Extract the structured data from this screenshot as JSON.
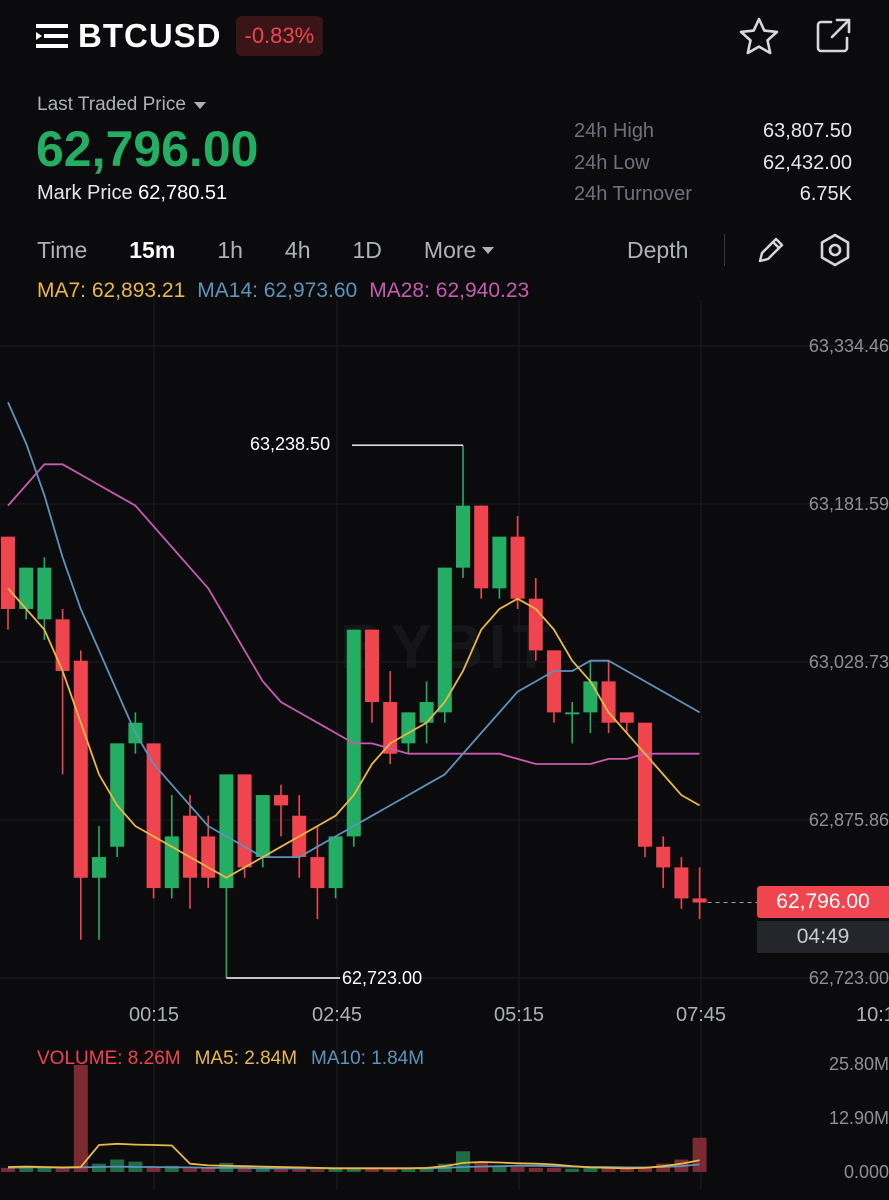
{
  "header": {
    "symbol": "BTCUSD",
    "change": "-0.83%"
  },
  "price": {
    "label": "Last Traded Price",
    "last": "62,796.00",
    "mark_label": "Mark Price",
    "mark": "62,780.51"
  },
  "stats": [
    {
      "label": "24h High",
      "value": "63,807.50"
    },
    {
      "label": "24h Low",
      "value": "62,432.00"
    },
    {
      "label": "24h Turnover",
      "value": "6.75K"
    }
  ],
  "timeframes": [
    "Time",
    "15m",
    "1h",
    "4h",
    "1D"
  ],
  "active_timeframe": "15m",
  "more_label": "More",
  "depth_label": "Depth",
  "ma_legend": {
    "ma7": "MA7: 62,893.21",
    "ma14": "MA14: 62,973.60",
    "ma28": "MA28: 62,940.23"
  },
  "volume_legend": {
    "volume": "VOLUME: 8.26M",
    "ma5": "MA5: 2.84M",
    "ma10": "MA10: 1.84M"
  },
  "watermark": "BYBIT",
  "colors": {
    "up": "#24ae64",
    "down": "#f0444f",
    "ma7": "#e9b845",
    "ma14": "#5c93bb",
    "ma28": "#c75bb1"
  },
  "icons": [
    "menu-icon",
    "star-icon",
    "share-icon",
    "pencil-icon",
    "settings-icon"
  ],
  "chart_data": {
    "type": "candlestick",
    "interval": "15m",
    "y_axis_labels": [
      "63,334.46",
      "63,181.59",
      "63,028.73",
      "62,875.86",
      "62,723.00"
    ],
    "ylim": [
      62723.0,
      63334.46
    ],
    "x_axis_labels": [
      "00:15",
      "02:45",
      "05:15",
      "07:45",
      "10:1"
    ],
    "high_marker": "63,238.50",
    "low_marker": "62,723.00",
    "current_price": "62,796.00",
    "countdown": "04:49",
    "candles": [
      {
        "o": 63150,
        "h": 63150,
        "c": 63080,
        "l": 63060
      },
      {
        "o": 63080,
        "h": 63120,
        "c": 63120,
        "l": 63070
      },
      {
        "o": 63070,
        "h": 63130,
        "c": 63120,
        "l": 63050
      },
      {
        "o": 63070,
        "h": 63080,
        "c": 63020,
        "l": 62920
      },
      {
        "o": 63030,
        "h": 63040,
        "c": 62820,
        "l": 62760
      },
      {
        "o": 62820,
        "h": 62870,
        "c": 62840,
        "l": 62760
      },
      {
        "o": 62850,
        "h": 62950,
        "c": 62950,
        "l": 62840
      },
      {
        "o": 62950,
        "h": 62980,
        "c": 62970,
        "l": 62940
      },
      {
        "o": 62950,
        "h": 62950,
        "c": 62810,
        "l": 62800
      },
      {
        "o": 62810,
        "h": 62900,
        "c": 62860,
        "l": 62800
      },
      {
        "o": 62880,
        "h": 62900,
        "c": 62820,
        "l": 62790
      },
      {
        "o": 62860,
        "h": 62880,
        "c": 62820,
        "l": 62810
      },
      {
        "o": 62810,
        "h": 62920,
        "c": 62920,
        "l": 62723
      },
      {
        "o": 62920,
        "h": 62920,
        "c": 62830,
        "l": 62820
      },
      {
        "o": 62840,
        "h": 62900,
        "c": 62900,
        "l": 62830
      },
      {
        "o": 62900,
        "h": 62910,
        "c": 62890,
        "l": 62860
      },
      {
        "o": 62880,
        "h": 62900,
        "c": 62840,
        "l": 62820
      },
      {
        "o": 62840,
        "h": 62870,
        "c": 62810,
        "l": 62780
      },
      {
        "o": 62810,
        "h": 62860,
        "c": 62860,
        "l": 62800
      },
      {
        "o": 62860,
        "h": 63060,
        "c": 63060,
        "l": 62850
      },
      {
        "o": 63060,
        "h": 63050,
        "c": 62990,
        "l": 62970
      },
      {
        "o": 62990,
        "h": 63020,
        "c": 62940,
        "l": 62930
      },
      {
        "o": 62950,
        "h": 62980,
        "c": 62980,
        "l": 62940
      },
      {
        "o": 62970,
        "h": 63010,
        "c": 62990,
        "l": 62950
      },
      {
        "o": 62980,
        "h": 63120,
        "c": 63120,
        "l": 62970
      },
      {
        "o": 63120,
        "h": 63238.5,
        "c": 63180,
        "l": 63110
      },
      {
        "o": 63180,
        "h": 63180,
        "c": 63100,
        "l": 63090
      },
      {
        "o": 63100,
        "h": 63140,
        "c": 63150,
        "l": 63090
      },
      {
        "o": 63150,
        "h": 63170,
        "c": 63090,
        "l": 63080
      },
      {
        "o": 63090,
        "h": 63110,
        "c": 63040,
        "l": 63030
      },
      {
        "o": 63040,
        "h": 63040,
        "c": 62980,
        "l": 62970
      },
      {
        "o": 62980,
        "h": 62990,
        "c": 62980,
        "l": 62950
      },
      {
        "o": 62980,
        "h": 63030,
        "c": 63010,
        "l": 62960
      },
      {
        "o": 63010,
        "h": 63030,
        "c": 62970,
        "l": 62960
      },
      {
        "o": 62980,
        "h": 62980,
        "c": 62970,
        "l": 62960
      },
      {
        "o": 62970,
        "h": 62970,
        "c": 62850,
        "l": 62840
      },
      {
        "o": 62850,
        "h": 62860,
        "c": 62830,
        "l": 62810
      },
      {
        "o": 62830,
        "h": 62840,
        "c": 62800,
        "l": 62790
      },
      {
        "o": 62800,
        "h": 62830,
        "c": 62796,
        "l": 62780
      }
    ],
    "ma7": [
      63100,
      63080,
      63060,
      63020,
      62970,
      62920,
      62890,
      62870,
      62860,
      62850,
      62840,
      62830,
      62820,
      62830,
      62840,
      62850,
      62860,
      62870,
      62880,
      62900,
      62930,
      62950,
      62960,
      62970,
      62990,
      63020,
      63060,
      63080,
      63090,
      63080,
      63060,
      63030,
      63010,
      62980,
      62960,
      62940,
      62920,
      62900,
      62890
    ],
    "ma14": [
      63280,
      63240,
      63190,
      63130,
      63080,
      63040,
      63000,
      62960,
      62930,
      62910,
      62890,
      62870,
      62860,
      62850,
      62840,
      62840,
      62840,
      62850,
      62860,
      62870,
      62880,
      62890,
      62900,
      62910,
      62920,
      62940,
      62960,
      62980,
      63000,
      63010,
      63020,
      63020,
      63030,
      63030,
      63020,
      63010,
      63000,
      62990,
      62980
    ],
    "ma28": [
      63180,
      63200,
      63220,
      63220,
      63210,
      63200,
      63190,
      63180,
      63160,
      63140,
      63120,
      63100,
      63070,
      63040,
      63010,
      62990,
      62980,
      62970,
      62960,
      62950,
      62950,
      62945,
      62940,
      62940,
      62940,
      62940,
      62940,
      62940,
      62935,
      62930,
      62930,
      62930,
      62930,
      62935,
      62935,
      62940,
      62940,
      62940,
      62940
    ],
    "volume_axis_labels": [
      "25.80M",
      "12.90M",
      "0.000"
    ],
    "volume_max": 25.8,
    "volumes": [
      1.0,
      1.5,
      1.2,
      0.8,
      25.8,
      2.0,
      3.0,
      2.5,
      1.2,
      1.5,
      0.9,
      1.2,
      2.2,
      1.5,
      1.0,
      0.8,
      0.7,
      0.6,
      0.9,
      1.0,
      0.8,
      0.7,
      0.6,
      1.0,
      2.0,
      5.0,
      2.5,
      1.5,
      1.2,
      1.0,
      1.0,
      0.8,
      1.0,
      0.9,
      0.8,
      1.2,
      2.0,
      3.0,
      8.26
    ],
    "volume_ma5": [
      1.2,
      1.3,
      1.2,
      1.1,
      1.2,
      6.5,
      6.8,
      6.6,
      6.5,
      6.4,
      2.0,
      1.6,
      1.5,
      1.4,
      1.3,
      1.2,
      1.1,
      1.0,
      0.9,
      0.9,
      0.9,
      0.9,
      0.9,
      1.0,
      1.4,
      2.2,
      2.4,
      2.3,
      2.1,
      2.0,
      1.8,
      1.4,
      1.1,
      1.0,
      0.9,
      1.0,
      1.4,
      2.0,
      2.84
    ],
    "volume_ma10": [
      1.0,
      1.1,
      1.1,
      1.0,
      1.1,
      1.2,
      1.3,
      1.2,
      1.2,
      1.1,
      1.1,
      1.0,
      1.0,
      1.0,
      0.9,
      0.9,
      0.9,
      0.9,
      0.9,
      0.9,
      0.9,
      0.9,
      0.9,
      0.9,
      1.0,
      1.2,
      1.3,
      1.4,
      1.5,
      1.5,
      1.4,
      1.3,
      1.2,
      1.2,
      1.1,
      1.1,
      1.2,
      1.4,
      1.84
    ]
  }
}
